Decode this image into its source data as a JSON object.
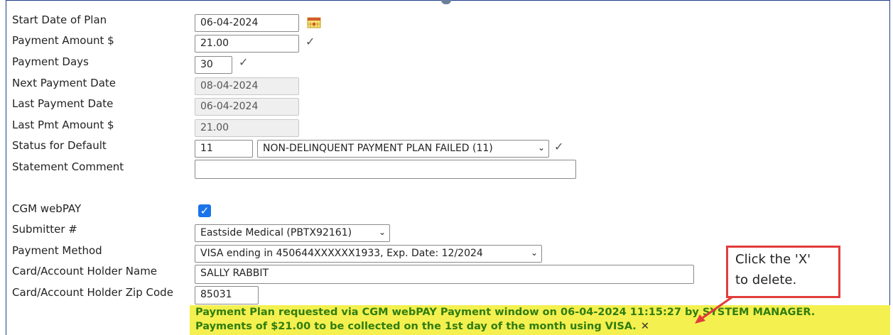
{
  "form": {
    "start_date": {
      "label": "Start Date of Plan",
      "value": "06-04-2024"
    },
    "payment_amount": {
      "label": "Payment Amount $",
      "value": "21.00"
    },
    "payment_days": {
      "label": "Payment Days",
      "value": "30"
    },
    "next_payment_date": {
      "label": "Next Payment Date",
      "value": "08-04-2024"
    },
    "last_payment_date": {
      "label": "Last Payment Date",
      "value": "06-04-2024"
    },
    "last_pmt_amount": {
      "label": "Last Pmt Amount $",
      "value": "21.00"
    },
    "status_default": {
      "label": "Status for Default",
      "code": "11",
      "selected": "NON-DELINQUENT PAYMENT PLAN FAILED (11)"
    },
    "statement_comment": {
      "label": "Statement Comment",
      "value": ""
    },
    "cgm_webpay": {
      "label": "CGM webPAY",
      "checked": true
    },
    "submitter": {
      "label": "Submitter #",
      "selected": "Eastside Medical (PBTX92161)"
    },
    "payment_method": {
      "label": "Payment Method",
      "selected": "VISA ending in 450644XXXXXX1933, Exp. Date: 12/2024"
    },
    "holder_name": {
      "label": "Card/Account Holder Name",
      "value": "SALLY RABBIT"
    },
    "holder_zip": {
      "label": "Card/Account Holder Zip Code",
      "value": "85031"
    }
  },
  "notice": {
    "line1": "Payment Plan requested via CGM webPAY Payment window on 06-04-2024 11:15:27 by SYSTEM MANAGER.",
    "line2": "Payments of $21.00 to be collected on the 1st day of the month using VISA.",
    "delete_glyph": "✕"
  },
  "callout": {
    "line1": "Click the 'X'",
    "line2": "to delete."
  },
  "icons": {
    "check": "✓",
    "chevron": "⌄",
    "calendar": "calendar-icon",
    "accent": "#e33c3c",
    "notice_bg": "#f4f04f",
    "notice_text": "#2f7d0f"
  }
}
